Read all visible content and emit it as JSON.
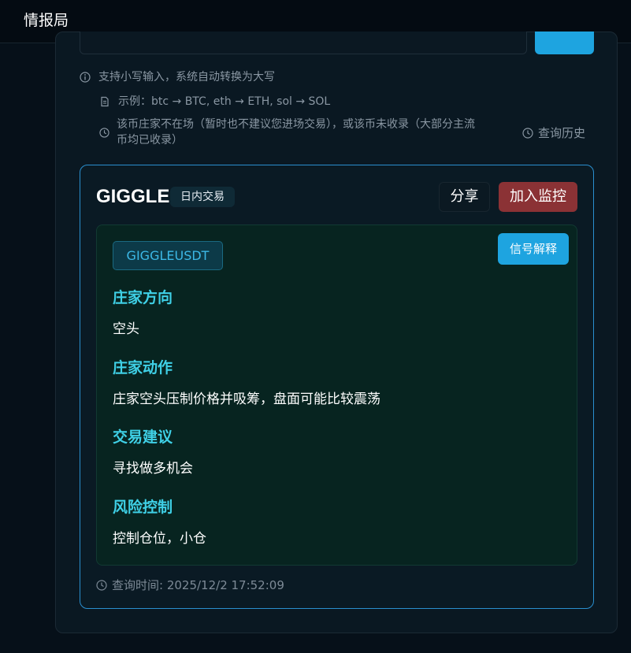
{
  "app": {
    "title": "情报局"
  },
  "hints": {
    "lowercase": "支持小写输入，系统自动转换为大写",
    "example": "示例：btc → BTC, eth → ETH, sol → SOL",
    "absent_line1": "该币庄家不在场（暂时也不建议您进场交易），或该币未收录（大部分主流",
    "absent_line2": "币均已收录）",
    "history": "查询历史"
  },
  "result": {
    "coin": "GIGGLE",
    "tag": "日内交易",
    "share_label": "分享",
    "monitor_label": "加入监控",
    "symbol": "GIGGLEUSDT",
    "explain_label": "信号解释",
    "sections": [
      {
        "heading": "庄家方向",
        "body": "空头"
      },
      {
        "heading": "庄家动作",
        "body": "庄家空头压制价格并吸筹，盘面可能比较震荡"
      },
      {
        "heading": "交易建议",
        "body": "寻找做多机会"
      },
      {
        "heading": "风险控制",
        "body": "控制仓位，小仓"
      }
    ],
    "query_time": "查询时间: 2025/12/2 17:52:09"
  },
  "icons": {
    "info": "info-circle-icon",
    "example": "document-icon",
    "absent": "clock-icon",
    "history": "clock-icon",
    "query_time": "clock-icon"
  },
  "colors": {
    "accent": "#1ea4e0",
    "danger": "#8b3235",
    "heading": "#3fd0e6",
    "card_border": "#2a8fcf"
  }
}
